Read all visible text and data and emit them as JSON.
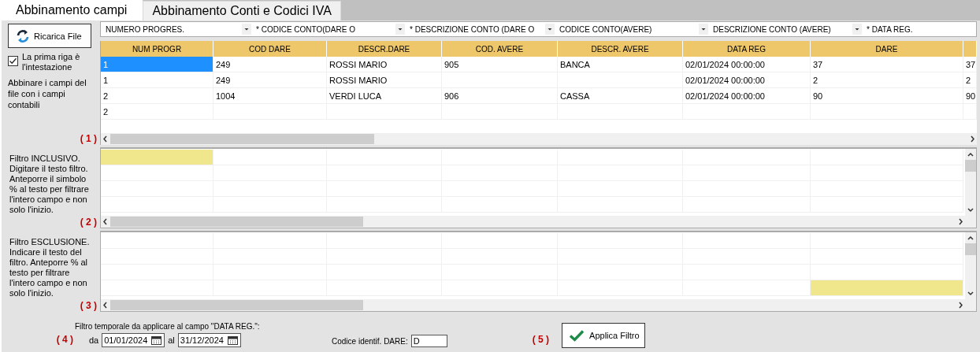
{
  "tabs": [
    {
      "label": "Abbinamento campi",
      "selected": true
    },
    {
      "label": "Abbinamento Conti e Codici IVA",
      "selected": false
    }
  ],
  "reload_button": "Ricarica File",
  "header_checkbox": {
    "label": "La prima riga è l'intestazione",
    "checked": true
  },
  "match_hint": "Abbinare i campi del file con i campi contabili",
  "field_combos": [
    "NUMERO PROGRES.",
    "* CODICE CONTO(DARE O",
    "* DESCRIZIONE CONTO (DARE O",
    "CODICE CONTO(AVERE)",
    "DESCRIZIONE CONTO (AVERE)",
    "* DATA REG."
  ],
  "data_grid": {
    "marker": "( 1 )",
    "columns": [
      "NUM PROGR",
      "COD DARE",
      "DESCR.DARE",
      "COD. AVERE",
      "DESCR. AVERE",
      "DATA REG",
      "DARE"
    ],
    "rows": [
      {
        "selected": true,
        "cells": [
          "1",
          "249",
          "ROSSI MARIO",
          "905",
          "BANCA",
          "02/01/2024 00:00:00",
          "37",
          "37"
        ]
      },
      {
        "selected": false,
        "cells": [
          "1",
          "249",
          "ROSSI MARIO",
          null,
          null,
          "02/01/2024 00:00:00",
          "2",
          "2"
        ]
      },
      {
        "selected": false,
        "cells": [
          "2",
          "1004",
          "VERDI LUCA",
          "906",
          "CASSA",
          "02/01/2024 00:00:00",
          "90",
          "90"
        ]
      },
      {
        "selected": false,
        "cells": [
          "2",
          null,
          null,
          null,
          null,
          null,
          null,
          null
        ]
      }
    ]
  },
  "include_filter": {
    "marker": "( 2 )",
    "description": "Filtro  INCLUSIVO. Digitare il testo filtro. Anteporre il simbolo % al testo per filtrare l'intero campo e non solo l'inizio.",
    "rows": [
      {
        "highlighted": [
          true,
          false,
          false,
          false,
          false,
          false,
          false
        ]
      },
      {
        "highlighted": [
          false,
          false,
          false,
          false,
          false,
          false,
          false
        ]
      },
      {
        "highlighted": [
          false,
          false,
          false,
          false,
          false,
          false,
          false
        ]
      },
      {
        "highlighted": [
          false,
          false,
          false,
          false,
          false,
          false,
          false
        ]
      }
    ]
  },
  "exclude_filter": {
    "marker": "( 3 )",
    "description": "Filtro ESCLUSIONE. Indicare il testo del filtro. Anteporre % al testo per filtrare l'intero campo e non solo l'inizio.",
    "rows": [
      {
        "highlighted": [
          false,
          false,
          false,
          false,
          false,
          false,
          false
        ]
      },
      {
        "highlighted": [
          false,
          false,
          false,
          false,
          false,
          false,
          false
        ]
      },
      {
        "highlighted": [
          false,
          false,
          false,
          false,
          false,
          false,
          false
        ]
      },
      {
        "highlighted": [
          false,
          false,
          false,
          false,
          false,
          false,
          true
        ]
      }
    ]
  },
  "date_filter": {
    "title": "Filtro temporale da applicare al campo \"DATA REG.\":",
    "marker": "( 4 )",
    "from_label": "da",
    "from": "01/01/2024",
    "to_label": "al",
    "to": "31/12/2024"
  },
  "dare_code": {
    "label": "Codice identif. DARE:",
    "value": "D"
  },
  "apply": {
    "marker": "( 5 )",
    "label": "Applica Filtro"
  }
}
